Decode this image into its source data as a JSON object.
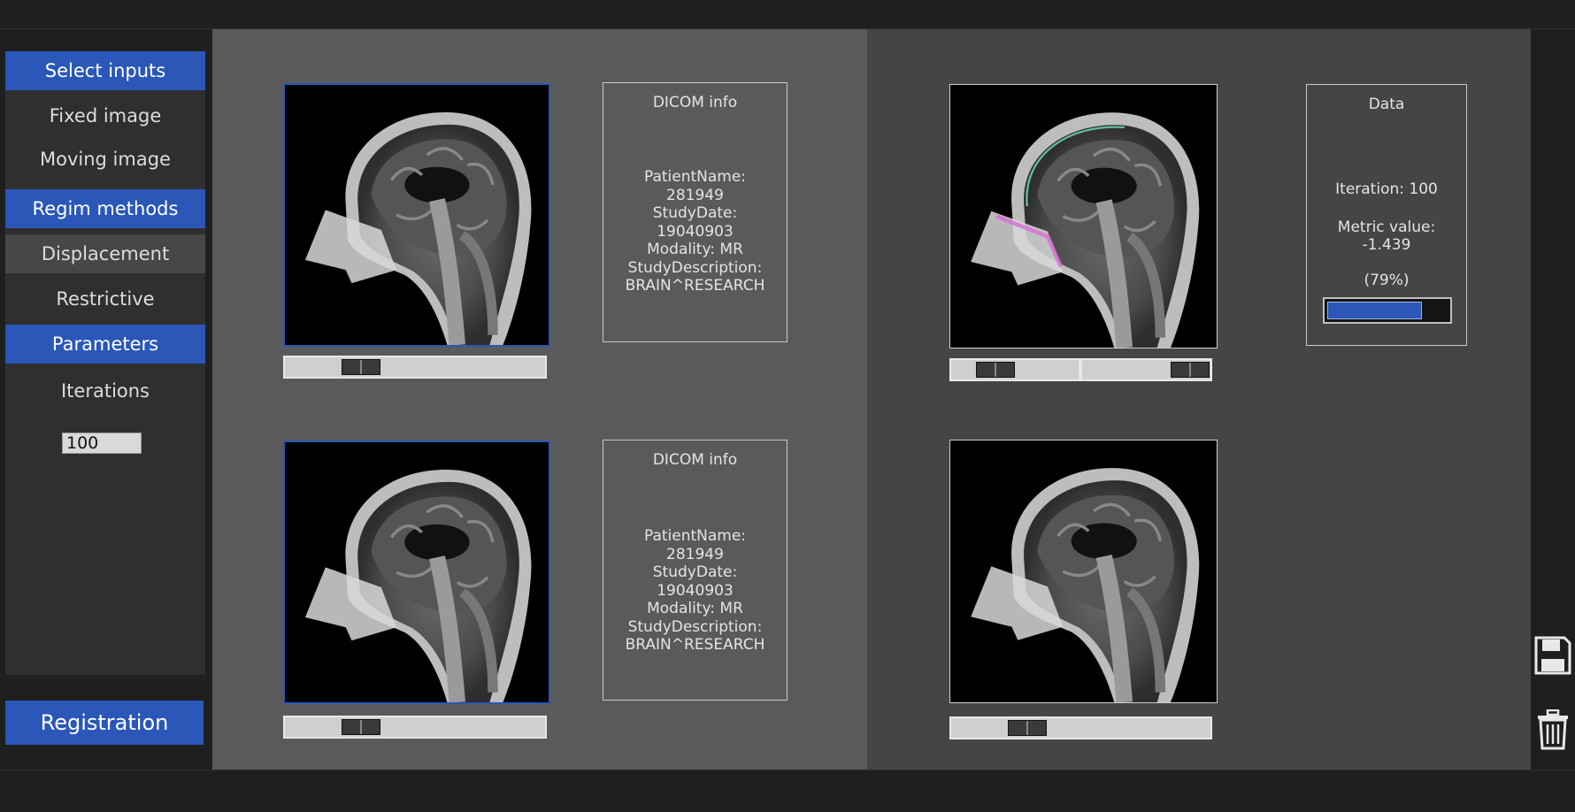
{
  "sidebar": {
    "select_inputs": "Select inputs",
    "fixed_image": "Fixed image",
    "moving_image": "Moving image",
    "regim_methods": "Regim methods",
    "displacement": "Displacement",
    "restrictive": "Restrictive",
    "parameters": "Parameters",
    "iterations_label": "Iterations",
    "iterations_value": "100"
  },
  "registration_button": "Registration",
  "fixed_dicom": {
    "title": "DICOM info",
    "lines": [
      "PatientName:",
      "281949",
      "StudyDate:",
      "19040903",
      "Modality: MR",
      "StudyDescription:",
      "BRAIN^RESEARCH"
    ]
  },
  "moving_dicom": {
    "title": "DICOM info",
    "lines": [
      "PatientName:",
      "281949",
      "StudyDate:",
      "19040903",
      "Modality: MR",
      "StudyDescription:",
      "BRAIN^RESEARCH"
    ]
  },
  "data_panel": {
    "title": "Data",
    "iteration": "Iteration: 100",
    "metric_label": "Metric value:",
    "metric_value": "-1.439",
    "percent_text": "(79%)",
    "progress": 0.79
  },
  "icons": {
    "save": "floppy-disk-icon",
    "delete": "trash-icon"
  },
  "colors": {
    "accent": "#2a57b8",
    "left_panel": "#5a5a5c",
    "right_panel": "#444547"
  }
}
